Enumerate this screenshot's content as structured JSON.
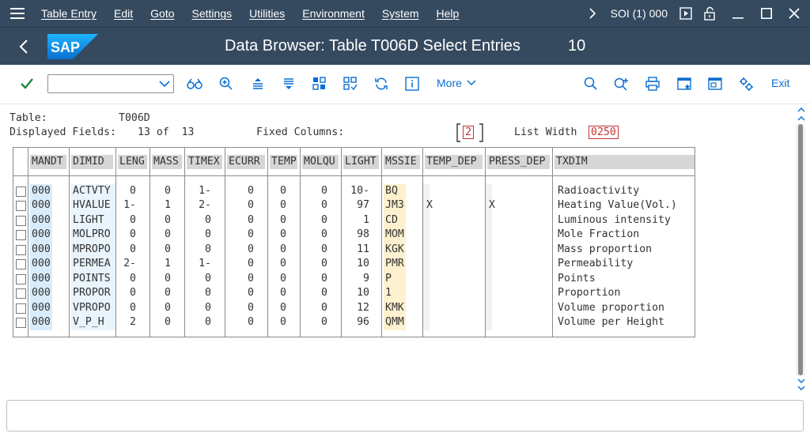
{
  "menu": {
    "items": [
      "Table Entry",
      "Edit",
      "Goto",
      "Settings",
      "Utilities",
      "Environment",
      "System",
      "Help"
    ],
    "system_info": "SOI (1) 000"
  },
  "titlebar": {
    "logo_text": "SAP",
    "title": "Data Browser: Table T006D Select Entries",
    "count": "10"
  },
  "toolbar": {
    "command_value": "",
    "more_label": "More",
    "exit_label": "Exit"
  },
  "info": {
    "table_label": "Table:",
    "table_value": "T006D",
    "displayed_label": "Displayed Fields:",
    "displayed_value": "13 of  13",
    "fixed_label": "Fixed Columns:",
    "fixed_value": "2",
    "width_label": "List Width",
    "width_value": "0250"
  },
  "table": {
    "columns": [
      "MANDT",
      "DIMID",
      "LENG",
      "MASS",
      "TIMEX",
      "ECURR",
      "TEMP",
      "MOLQU",
      "LIGHT",
      "MSSIE",
      "TEMP_DEP",
      "PRESS_DEP",
      "TXDIM"
    ],
    "rows": [
      [
        "000",
        "ACTVTY",
        "0",
        "0",
        "1-",
        "0",
        "0",
        "0",
        "10-",
        "BQ",
        "",
        "",
        "Radioactivity"
      ],
      [
        "000",
        "HVALUE",
        "1-",
        "1",
        "2-",
        "0",
        "0",
        "0",
        "97",
        "JM3",
        "X",
        "X",
        "Heating Value(Vol.)"
      ],
      [
        "000",
        "LIGHT",
        "0",
        "0",
        "0",
        "0",
        "0",
        "0",
        "1",
        "CD",
        "",
        "",
        "Luminous intensity"
      ],
      [
        "000",
        "MOLPRO",
        "0",
        "0",
        "0",
        "0",
        "0",
        "0",
        "98",
        "MOM",
        "",
        "",
        "Mole Fraction"
      ],
      [
        "000",
        "MPROPO",
        "0",
        "0",
        "0",
        "0",
        "0",
        "0",
        "11",
        "KGK",
        "",
        "",
        "Mass proportion"
      ],
      [
        "000",
        "PERMEA",
        "2-",
        "1",
        "1-",
        "0",
        "0",
        "0",
        "10",
        "PMR",
        "",
        "",
        "Permeability"
      ],
      [
        "000",
        "POINTS",
        "0",
        "0",
        "0",
        "0",
        "0",
        "0",
        "9",
        "P",
        "",
        "",
        "Points"
      ],
      [
        "000",
        "PROPOR",
        "0",
        "0",
        "0",
        "0",
        "0",
        "0",
        "10",
        "1",
        "",
        "",
        "Proportion"
      ],
      [
        "000",
        "VPROPO",
        "0",
        "0",
        "0",
        "0",
        "0",
        "0",
        "12",
        "KMK",
        "",
        "",
        "Volume proportion"
      ],
      [
        "000",
        "V_P_H",
        "2",
        "0",
        "0",
        "0",
        "0",
        "0",
        "96",
        "QMM",
        "",
        "",
        "Volume per Height"
      ]
    ]
  },
  "colors": {
    "shell": "#354a5f",
    "accent": "#0a6ed1",
    "key_column": "#d9ecfb",
    "unit_column": "#fdf1cf",
    "highlight_value": "#c23434"
  }
}
